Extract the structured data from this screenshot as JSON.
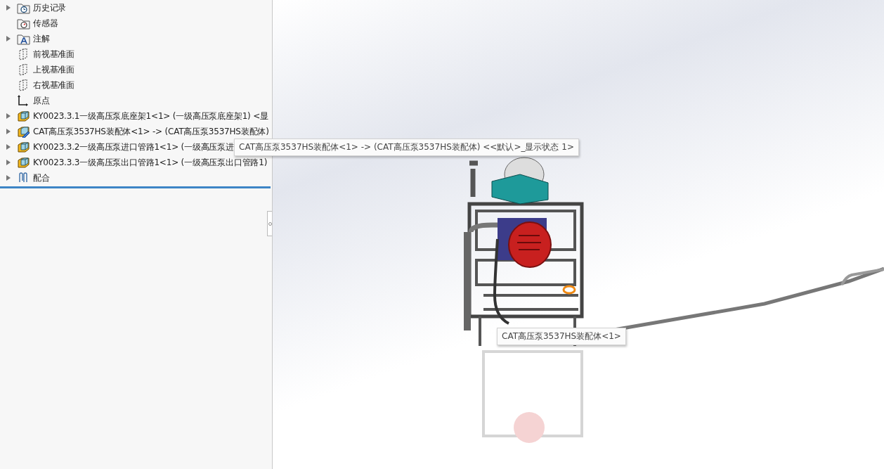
{
  "feature_tree": {
    "items": [
      {
        "kind": "history",
        "label": "历史记录",
        "expandable": true
      },
      {
        "kind": "sensor",
        "label": "传感器",
        "expandable": false
      },
      {
        "kind": "annotation",
        "label": "注解",
        "expandable": true
      },
      {
        "kind": "plane",
        "label": "前视基准面",
        "expandable": false
      },
      {
        "kind": "plane",
        "label": "上视基准面",
        "expandable": false
      },
      {
        "kind": "plane",
        "label": "右视基准面",
        "expandable": false
      },
      {
        "kind": "origin",
        "label": "原点",
        "expandable": false
      },
      {
        "kind": "part",
        "label": "KY0023.3.1一级高压泵底座架1<1> (一级高压泵底座架1) <显",
        "expandable": true
      },
      {
        "kind": "assembly",
        "label": "CAT高压泵3537HS装配体<1> -> (CAT高压泵3537HS装配体)",
        "expandable": true
      },
      {
        "kind": "part",
        "label": "KY0023.3.2一级高压泵进口管路1<1> (一级高压泵进",
        "expandable": true
      },
      {
        "kind": "part",
        "label": "KY0023.3.3一级高压泵出口管路1<1> (一级高压泵出口管路1)",
        "expandable": true
      },
      {
        "kind": "mates",
        "label": "配合",
        "expandable": true
      }
    ]
  },
  "tree_tooltip": "CAT高压泵3537HS装配体<1> -> (CAT高压泵3537HS装配体) <<默认>_显示状态 1>",
  "viewport_tooltip": "CAT高压泵3537HS装配体<1>"
}
